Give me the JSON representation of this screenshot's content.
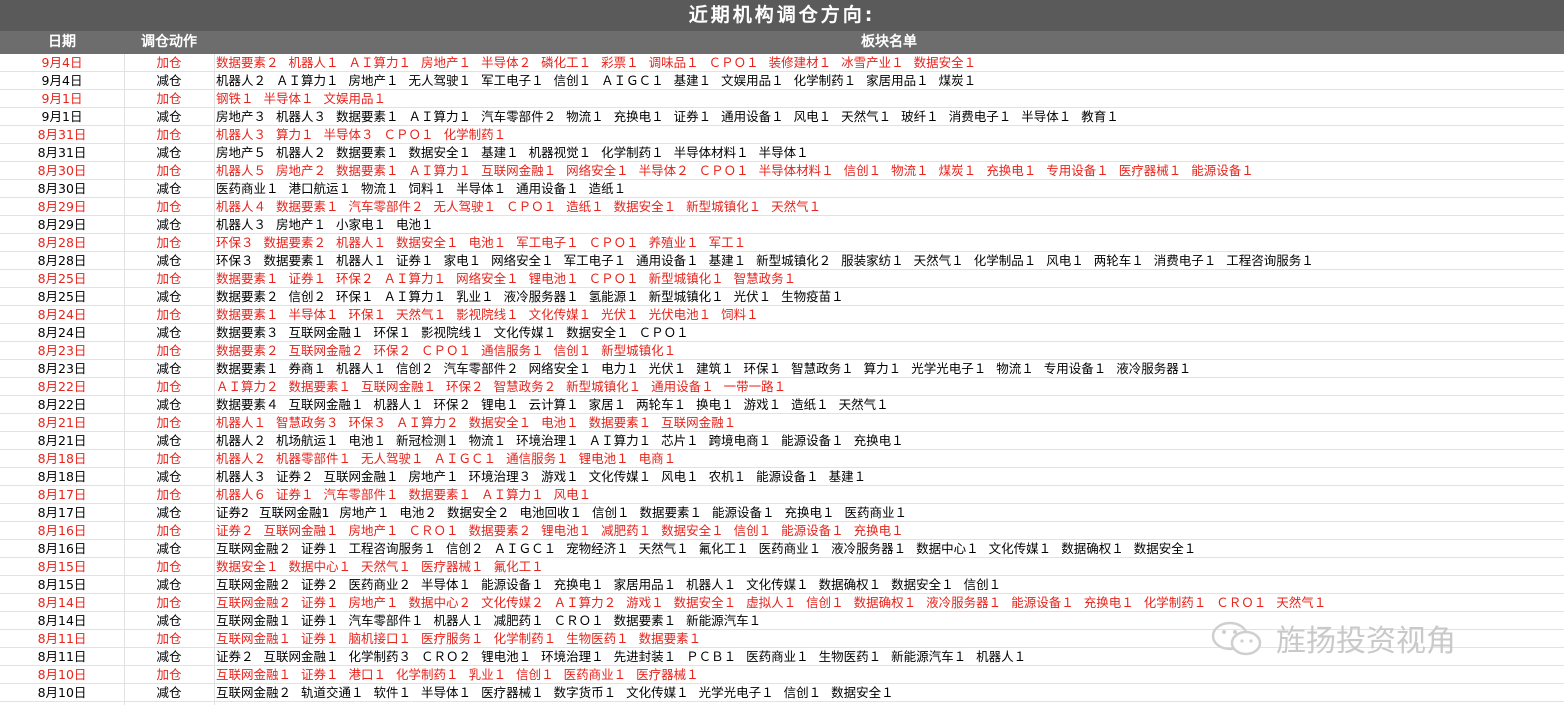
{
  "title": "近期机构调仓方向:",
  "headers": {
    "date": "日期",
    "action": "调仓动作",
    "sectors": "板块名单"
  },
  "colors": {
    "add": "#e8231b",
    "reduce": "#000000",
    "title_bg": "#5a5a5a",
    "header_bg": "#6d6d6d"
  },
  "watermark": {
    "text": "旌扬投资视角",
    "icon": "wechat-icon"
  },
  "rows": [
    {
      "date": "9月4日",
      "action": "加仓",
      "type": "add",
      "sectors": [
        "数据要素２",
        "机器人１",
        "ＡＩ算力１",
        "房地产１",
        "半导体２",
        "磷化工１",
        "彩票１",
        "调味品１",
        "ＣＰＯ１",
        "装修建材１",
        "冰雪产业１",
        "数据安全１"
      ]
    },
    {
      "date": "9月4日",
      "action": "减仓",
      "type": "reduce",
      "sectors": [
        "机器人２",
        "ＡＩ算力１",
        "房地产１",
        "无人驾驶１",
        "军工电子１",
        "信创１",
        "ＡＩＧＣ１",
        "基建１",
        "文娱用品１",
        "化学制药１",
        "家居用品１",
        "煤炭１"
      ]
    },
    {
      "date": "9月1日",
      "action": "加仓",
      "type": "add",
      "sectors": [
        "钢铁１",
        "半导体１",
        "文娱用品１"
      ]
    },
    {
      "date": "9月1日",
      "action": "减仓",
      "type": "reduce",
      "sectors": [
        "房地产３",
        "机器人３",
        "数据要素１",
        "ＡＩ算力１",
        "汽车零部件２",
        "物流１",
        "充换电１",
        "证券１",
        "通用设备１",
        "风电１",
        "天然气１",
        "玻纤１",
        "消费电子１",
        "半导体１",
        "教育１"
      ]
    },
    {
      "date": "8月31日",
      "action": "加仓",
      "type": "add",
      "sectors": [
        "机器人３",
        "算力１",
        "半导体３",
        "ＣＰＯ１",
        "化学制药１"
      ]
    },
    {
      "date": "8月31日",
      "action": "减仓",
      "type": "reduce",
      "sectors": [
        "房地产５",
        "机器人２",
        "数据要素１",
        "数据安全１",
        "基建１",
        "机器视觉１",
        "化学制药１",
        "半导体材料１",
        "半导体１"
      ]
    },
    {
      "date": "8月30日",
      "action": "加仓",
      "type": "add",
      "sectors": [
        "机器人５",
        "房地产２",
        "数据要素１",
        "ＡＩ算力１",
        "互联网金融１",
        "网络安全１",
        "半导体２",
        "ＣＰＯ１",
        "半导体材料１",
        "信创１",
        "物流１",
        "煤炭１",
        "充换电１",
        "专用设备１",
        "医疗器械１",
        "能源设备１"
      ]
    },
    {
      "date": "8月30日",
      "action": "减仓",
      "type": "reduce",
      "sectors": [
        "医药商业１",
        "港口航运１",
        "物流１",
        "饲料１",
        "半导体１",
        "通用设备１",
        "造纸１"
      ]
    },
    {
      "date": "8月29日",
      "action": "加仓",
      "type": "add",
      "sectors": [
        "机器人４",
        "数据要素１",
        "汽车零部件２",
        "无人驾驶１",
        "ＣＰＯ１",
        "造纸１",
        "数据安全１",
        "新型城镇化１",
        "天然气１"
      ]
    },
    {
      "date": "8月29日",
      "action": "减仓",
      "type": "reduce",
      "sectors": [
        "机器人３",
        "房地产１",
        "小家电１",
        "电池１"
      ]
    },
    {
      "date": "8月28日",
      "action": "加仓",
      "type": "add",
      "sectors": [
        "环保３",
        "数据要素２",
        "机器人１",
        "数据安全１",
        "电池１",
        "军工电子１",
        "ＣＰＯ１",
        "养殖业１",
        "军工１"
      ]
    },
    {
      "date": "8月28日",
      "action": "减仓",
      "type": "reduce",
      "sectors": [
        "环保３",
        "数据要素１",
        "机器人１",
        "证券１",
        "家电１",
        "网络安全１",
        "军工电子１",
        "通用设备１",
        "基建１",
        "新型城镇化２",
        "服装家纺１",
        "天然气１",
        "化学制品１",
        "风电１",
        "两轮车１",
        "消费电子１",
        "工程咨询服务１"
      ]
    },
    {
      "date": "8月25日",
      "action": "加仓",
      "type": "add",
      "sectors": [
        "数据要素１",
        "证券１",
        "环保２",
        "ＡＩ算力１",
        "网络安全１",
        "锂电池１",
        "ＣＰＯ１",
        "新型城镇化１",
        "智慧政务１"
      ]
    },
    {
      "date": "8月25日",
      "action": "减仓",
      "type": "reduce",
      "sectors": [
        "数据要素２",
        "信创２",
        "环保１",
        "ＡＩ算力１",
        "乳业１",
        "液冷服务器１",
        "氢能源１",
        "新型城镇化１",
        "光伏１",
        "生物疫苗１"
      ]
    },
    {
      "date": "8月24日",
      "action": "加仓",
      "type": "add",
      "sectors": [
        "数据要素１",
        "半导体１",
        "环保１",
        "天然气１",
        "影视院线１",
        "文化传媒１",
        "光伏１",
        "光伏电池１",
        "饲料１"
      ]
    },
    {
      "date": "8月24日",
      "action": "减仓",
      "type": "reduce",
      "sectors": [
        "数据要素３",
        "互联网金融１",
        "环保１",
        "影视院线１",
        "文化传媒１",
        "数据安全１",
        "ＣＰＯ１"
      ]
    },
    {
      "date": "8月23日",
      "action": "加仓",
      "type": "add",
      "sectors": [
        "数据要素２",
        "互联网金融２",
        "环保２",
        "ＣＰＯ１",
        "通信服务１",
        "信创１",
        "新型城镇化１"
      ]
    },
    {
      "date": "8月23日",
      "action": "减仓",
      "type": "reduce",
      "sectors": [
        "数据要素１",
        "券商１",
        "机器人１",
        "信创２",
        "汽车零部件２",
        "网络安全１",
        "电力１",
        "光伏１",
        "建筑１",
        "环保１",
        "智慧政务１",
        "算力１",
        "光学光电子１",
        "物流１",
        "专用设备１",
        "液冷服务器１"
      ]
    },
    {
      "date": "8月22日",
      "action": "加仓",
      "type": "add",
      "sectors": [
        "ＡＩ算力２",
        "数据要素１",
        "互联网金融１",
        "环保２",
        "智慧政务２",
        "新型城镇化１",
        "通用设备１",
        "一带一路１"
      ]
    },
    {
      "date": "8月22日",
      "action": "减仓",
      "type": "reduce",
      "sectors": [
        "数据要素４",
        "互联网金融１",
        "机器人１",
        "环保２",
        "锂电１",
        "云计算１",
        "家居１",
        "两轮车１",
        "换电１",
        "游戏１",
        "造纸１",
        "天然气１"
      ]
    },
    {
      "date": "8月21日",
      "action": "加仓",
      "type": "add",
      "sectors": [
        "机器人１",
        "智慧政务３",
        "环保３",
        "ＡＩ算力２",
        "数据安全１",
        "电池１",
        "数据要素１",
        "互联网金融１"
      ]
    },
    {
      "date": "8月21日",
      "action": "减仓",
      "type": "reduce",
      "sectors": [
        "机器人２",
        "机场航运１",
        "电池１",
        "新冠检测１",
        "物流１",
        "环境治理１",
        "ＡＩ算力１",
        "芯片１",
        "跨境电商１",
        "能源设备１",
        "充换电１"
      ]
    },
    {
      "date": "8月18日",
      "action": "加仓",
      "type": "add",
      "sectors": [
        "机器人２",
        "机器零部件１",
        "无人驾驶１",
        "ＡＩＧＣ１",
        "通信服务１",
        "锂电池１",
        "电商１"
      ]
    },
    {
      "date": "8月18日",
      "action": "减仓",
      "type": "reduce",
      "sectors": [
        "机器人３",
        "证券２",
        "互联网金融１",
        "房地产１",
        "环境治理３",
        "游戏１",
        "文化传媒１",
        "风电１",
        "农机１",
        "能源设备１",
        "基建１"
      ]
    },
    {
      "date": "8月17日",
      "action": "加仓",
      "type": "add",
      "sectors": [
        "机器人６",
        "证券１",
        "汽车零部件１",
        "数据要素１",
        "ＡＩ算力１",
        "风电１"
      ]
    },
    {
      "date": "8月17日",
      "action": "减仓",
      "type": "reduce",
      "sectors": [
        "证券2",
        "互联网金融1",
        "房地产１",
        "电池２",
        "数据安全２",
        "电池回收１",
        "信创１",
        "数据要素１",
        "能源设备１",
        "充换电１",
        "医药商业１"
      ]
    },
    {
      "date": "8月16日",
      "action": "加仓",
      "type": "add",
      "sectors": [
        "证券２",
        "互联网金融１",
        "房地产１",
        "ＣＲＯ１",
        "数据要素２",
        "锂电池１",
        "减肥药１",
        "数据安全１",
        "信创１",
        "能源设备１",
        "充换电１"
      ]
    },
    {
      "date": "8月16日",
      "action": "减仓",
      "type": "reduce",
      "sectors": [
        "互联网金融２",
        "证券１",
        "工程咨询服务１",
        "信创２",
        "ＡＩＧＣ１",
        "宠物经济１",
        "天然气１",
        "氟化工１",
        "医药商业１",
        "液冷服务器１",
        "数据中心１",
        "文化传媒１",
        "数据确权１",
        "数据安全１"
      ]
    },
    {
      "date": "8月15日",
      "action": "加仓",
      "type": "add",
      "sectors": [
        "数据安全１",
        "数据中心１",
        "天然气１",
        "医疗器械１",
        "氟化工１"
      ]
    },
    {
      "date": "8月15日",
      "action": "减仓",
      "type": "reduce",
      "sectors": [
        "互联网金融２",
        "证券２",
        "医药商业２",
        "半导体１",
        "能源设备１",
        "充换电１",
        "家居用品１",
        "机器人１",
        "文化传媒１",
        "数据确权１",
        "数据安全１",
        "信创１"
      ]
    },
    {
      "date": "8月14日",
      "action": "加仓",
      "type": "add",
      "sectors": [
        "互联网金融２",
        "证券１",
        "房地产１",
        "数据中心２",
        "文化传媒２",
        "ＡＩ算力２",
        "游戏１",
        "数据安全１",
        "虚拟人１",
        "信创１",
        "数据确权１",
        "液冷服务器１",
        "能源设备１",
        "充换电１",
        "化学制药１",
        "ＣＲＯ１",
        "天然气１"
      ]
    },
    {
      "date": "8月14日",
      "action": "减仓",
      "type": "reduce",
      "sectors": [
        "互联网金融１",
        "证券１",
        "汽车零部件１",
        "机器人１",
        "减肥药１",
        "ＣＲＯ１",
        "数据要素１",
        "新能源汽车１"
      ]
    },
    {
      "date": "8月11日",
      "action": "加仓",
      "type": "add",
      "sectors": [
        "互联网金融１",
        "证券１",
        "脑机接口１",
        "医疗服务１",
        "化学制药１",
        "生物医药１",
        "数据要素１"
      ]
    },
    {
      "date": "8月11日",
      "action": "减仓",
      "type": "reduce",
      "sectors": [
        "证券２",
        "互联网金融１",
        "化学制药３",
        "ＣＲＯ２",
        "锂电池１",
        "环境治理１",
        "先进封装１",
        "ＰＣＢ１",
        "医药商业１",
        "生物医药１",
        "新能源汽车１",
        "机器人１"
      ]
    },
    {
      "date": "8月10日",
      "action": "加仓",
      "type": "add",
      "sectors": [
        "互联网金融１",
        "证券１",
        "港口１",
        "化学制药１",
        "乳业１",
        "信创１",
        "医药商业１",
        "医疗器械１"
      ]
    },
    {
      "date": "8月10日",
      "action": "减仓",
      "type": "reduce",
      "sectors": [
        "互联网金融２",
        "轨道交通１",
        "软件１",
        "半导体１",
        "医疗器械１",
        "数字货币１",
        "文化传媒１",
        "光学光电子１",
        "信创１",
        "数据安全１"
      ]
    }
  ]
}
